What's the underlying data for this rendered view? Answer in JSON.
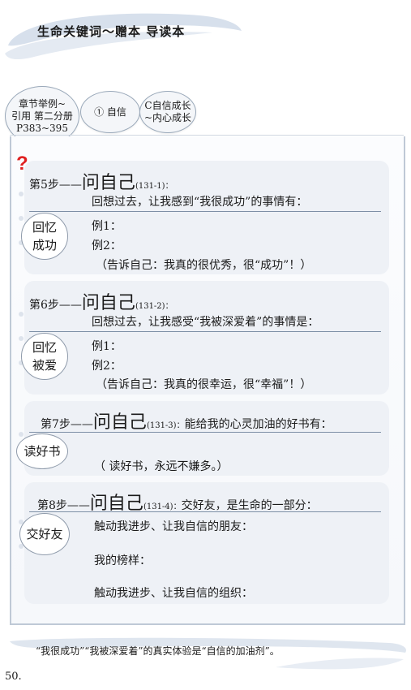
{
  "header": {
    "title": "生命关键词～赠本 导读本"
  },
  "chips": {
    "chapter": [
      "章节举例~",
      "引用 第二分册",
      "P383~395"
    ],
    "topic": "① 自信",
    "sub": [
      "C自信成长",
      "~内心成长"
    ]
  },
  "steps": [
    {
      "prefix": "第5步——",
      "heading": "问自己",
      "code": "(131-1)：",
      "after": "",
      "prompt": "回想过去，让我感到“我很成功”的事情有：",
      "label": [
        "回忆",
        "成功"
      ],
      "lines": [
        "例1：",
        "例2：",
        "（告诉自己：我真的很优秀，很“成功”！）"
      ]
    },
    {
      "prefix": "第6步——",
      "heading": "问自己",
      "code": "(131-2)：",
      "after": "",
      "prompt": "回想过去，让我感受“我被深爱着”的事情是：",
      "label": [
        "回忆",
        "被爱"
      ],
      "lines": [
        "例1：",
        "例2：",
        "（告诉自己：我真的很幸运，很“幸福”！）"
      ]
    },
    {
      "prefix": "第7步——",
      "heading": "问自己",
      "code": "(131-3)：",
      "after": "能给我的心灵加油的好书有：",
      "label": [
        "读好书"
      ],
      "lines": [
        "（ 读好书，永远不嫌多。）"
      ]
    },
    {
      "prefix": "第8步——",
      "heading": "问自己",
      "code": "(131-4)：",
      "after": "交好友，是生命的一部分：",
      "label": [
        "交好友"
      ],
      "lines": [
        "触动我进步、让我自信的朋友：",
        "我的榜样：",
        "触动我进步、让我自信的组织："
      ]
    }
  ],
  "footer": {
    "quote": "“我很成功”“我被深爱着”的真实体验是“自信的加油剂”。"
  },
  "page_number": "50."
}
